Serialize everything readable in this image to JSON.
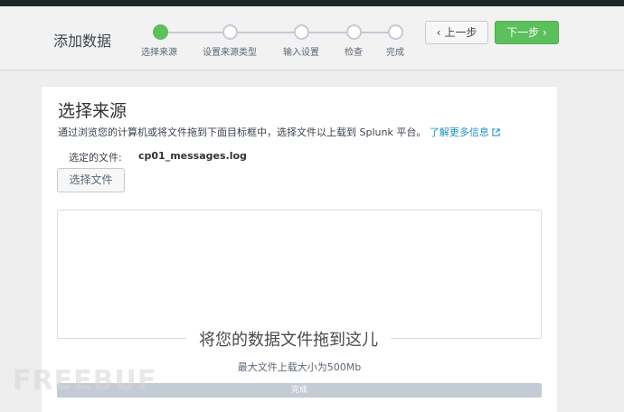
{
  "header": {
    "title": "添加数据",
    "prev_label": "上一步",
    "next_label": "下一步"
  },
  "wizard": {
    "steps": [
      {
        "label": "选择来源",
        "active": true
      },
      {
        "label": "设置来源类型",
        "active": false
      },
      {
        "label": "输入设置",
        "active": false
      },
      {
        "label": "检查",
        "active": false
      },
      {
        "label": "完成",
        "active": false
      }
    ]
  },
  "main": {
    "section_title": "选择来源",
    "description": "通过浏览您的计算机或将文件拖到下面目标框中，选择文件以上载到 Splunk 平台。",
    "learn_more": "了解更多信息",
    "selected_file_label": "选定的文件:",
    "selected_file_name": "cp01_messages.log",
    "choose_file_button": "选择文件",
    "drop_title": "将您的数据文件拖到这儿",
    "max_size": "最大文件上载大小为500Mb",
    "progress_label": "完成",
    "progress_value": 1.0
  },
  "watermark": "FREEBUF",
  "colors": {
    "accent_green": "#5cc05c",
    "link_blue": "#1e93c6",
    "topbar": "#212527"
  }
}
